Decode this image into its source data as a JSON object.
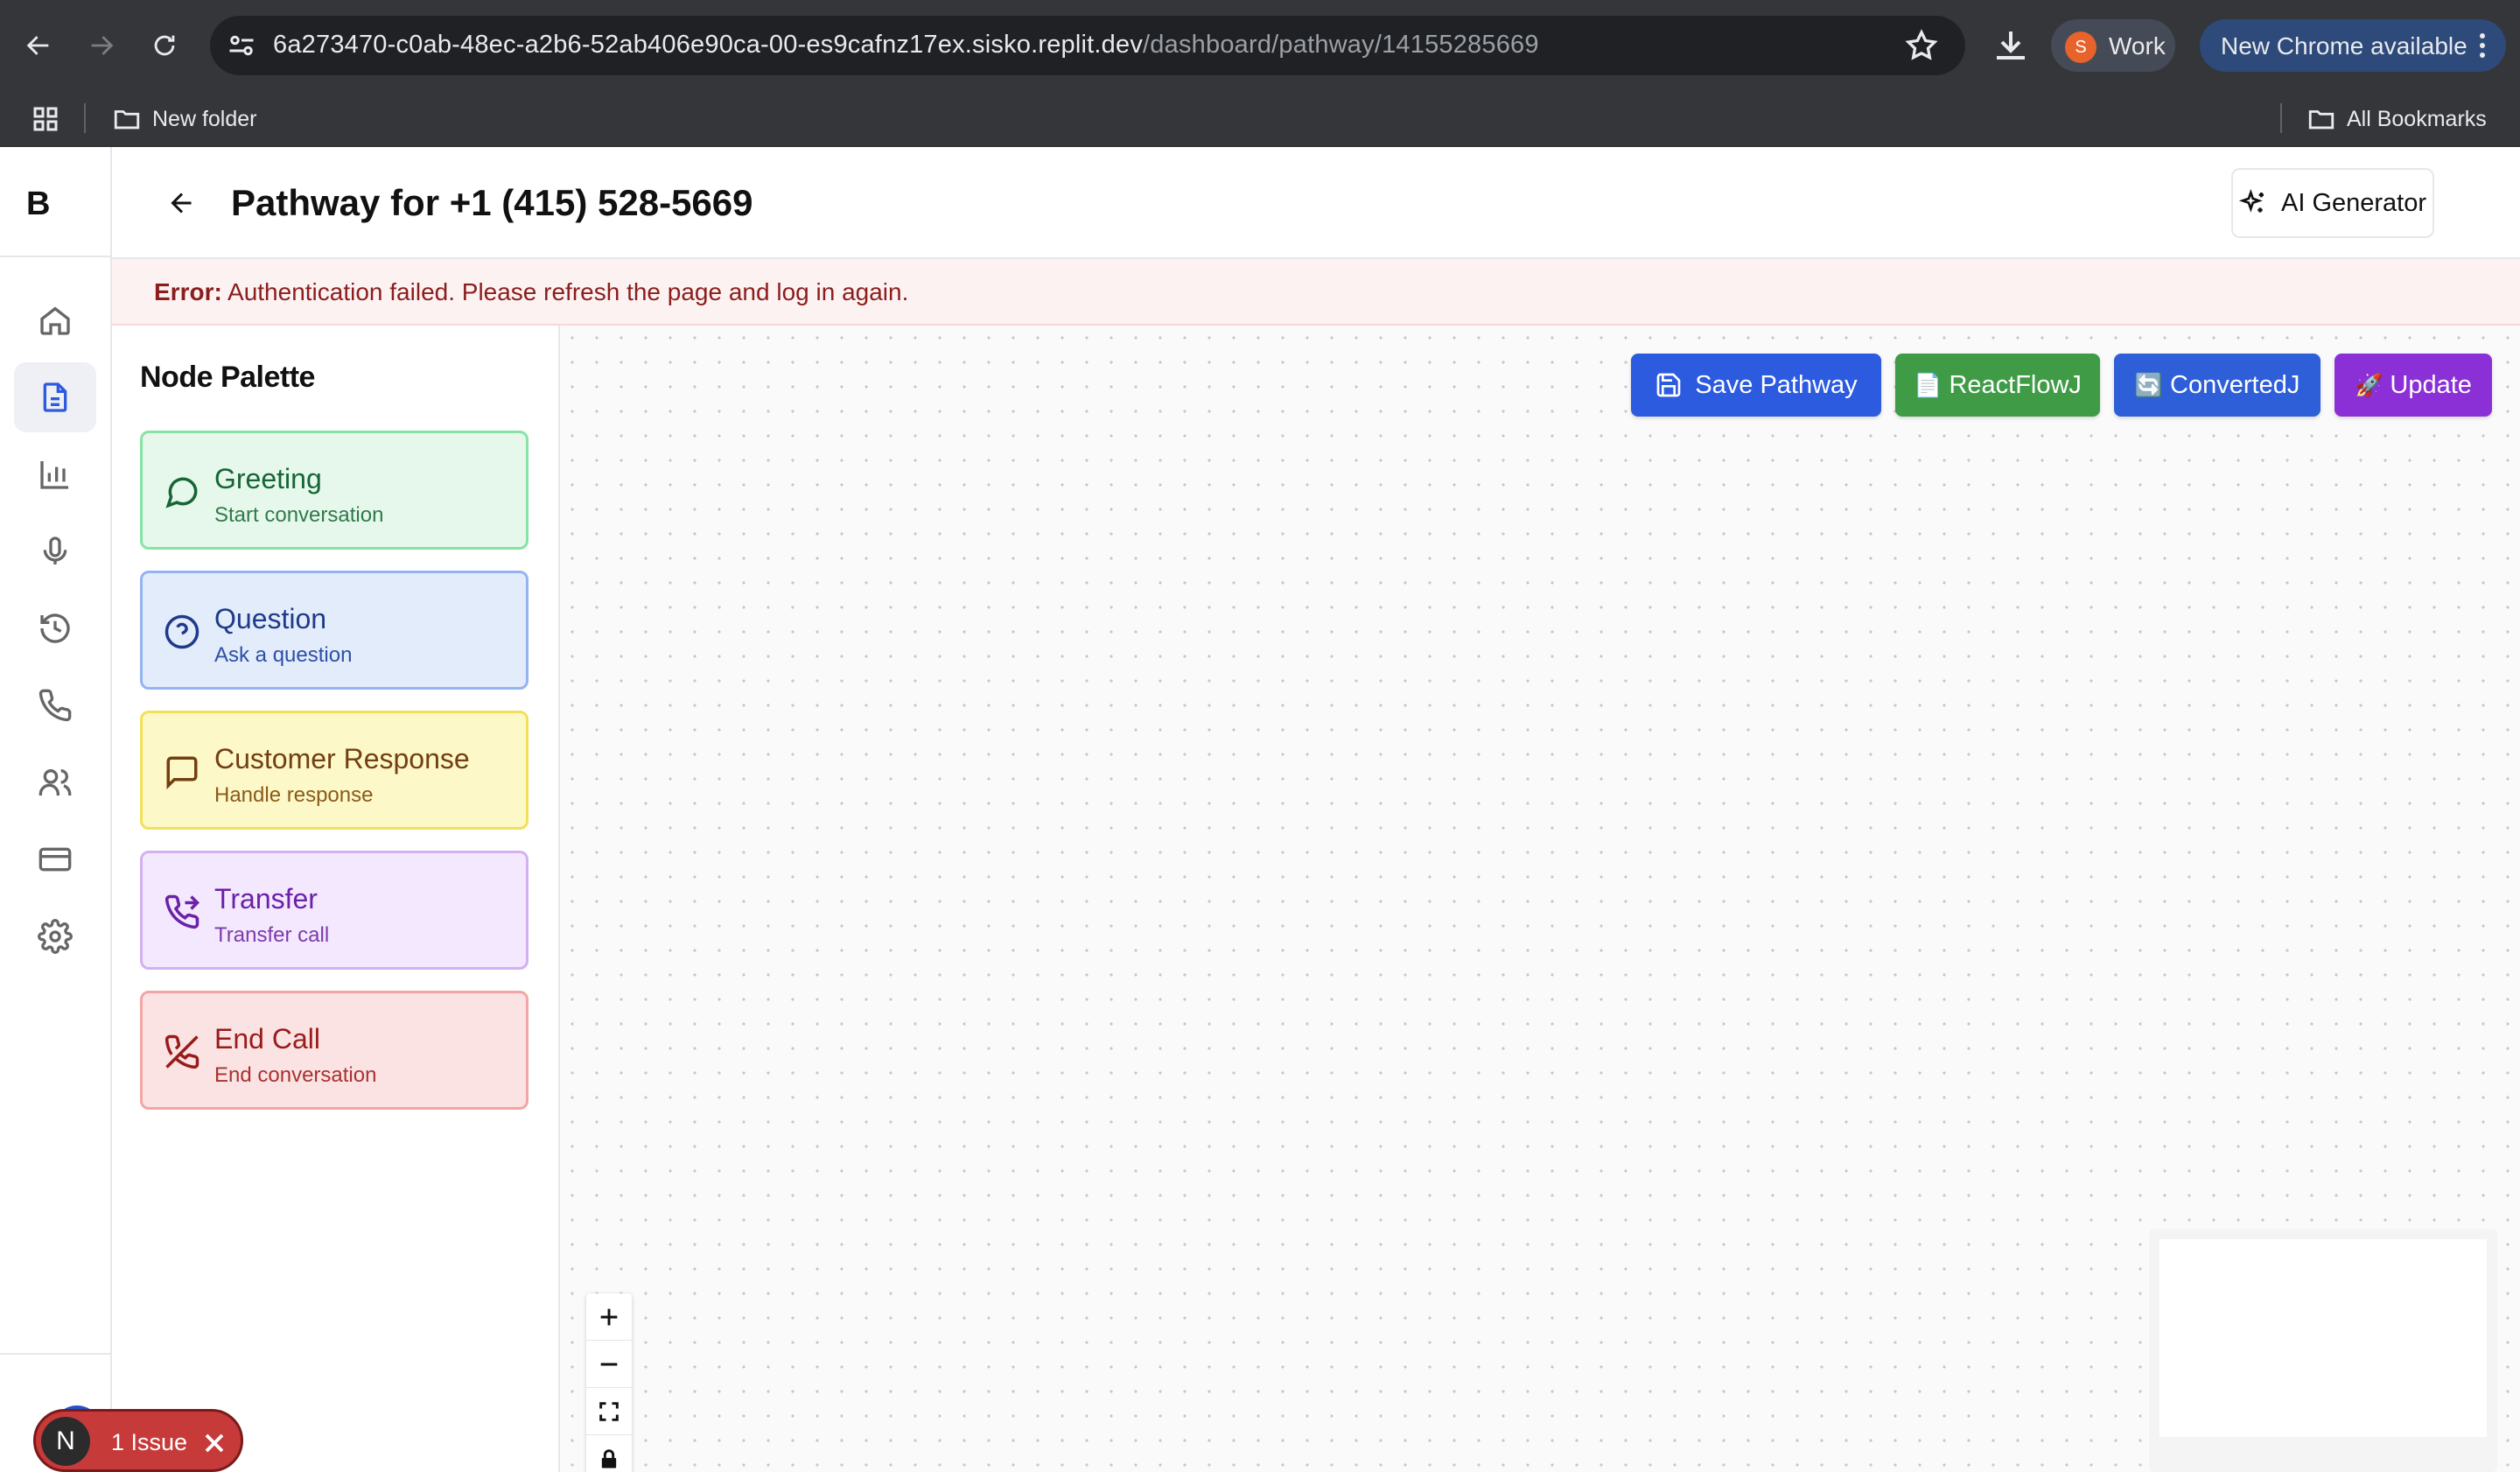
{
  "browser": {
    "url_host": "6a273470-c0ab-48ec-a2b6-52ab406e90ca-00-es9cafnz17ex.sisko.replit.dev",
    "url_path": "/dashboard/pathway/14155285669",
    "profile_initial": "S",
    "profile_label": "Work",
    "update_label": "New Chrome available",
    "bookmarks": {
      "folder": "New folder",
      "all": "All Bookmarks"
    }
  },
  "app": {
    "logo": "B",
    "sidebar": [
      "home-icon",
      "document-icon",
      "bar-chart-icon",
      "microphone-icon",
      "history-icon",
      "phone-icon",
      "users-icon",
      "credit-card-icon",
      "settings-icon"
    ],
    "active_sidebar": "document-icon"
  },
  "header": {
    "title": "Pathway for +1 (415) 528-5669",
    "ai_button": "AI Generator"
  },
  "error": {
    "label": "Error:",
    "message": "Authentication failed. Please refresh the page and log in again."
  },
  "palette": {
    "title": "Node Palette",
    "nodes": [
      {
        "name": "Greeting",
        "desc": "Start conversation",
        "icon": "message-circle-icon",
        "bg": "#e6f8ec",
        "border": "#86e3a5",
        "text": "#166534",
        "sub": "#2f7a48"
      },
      {
        "name": "Question",
        "desc": "Ask a question",
        "icon": "help-circle-icon",
        "bg": "#e3ecfb",
        "border": "#93b4f0",
        "text": "#1e3a8a",
        "sub": "#2d4fa6"
      },
      {
        "name": "Customer Response",
        "desc": "Handle response",
        "icon": "message-square-icon",
        "bg": "#fdf8c8",
        "border": "#f2e05a",
        "text": "#713f12",
        "sub": "#8a5a1a"
      },
      {
        "name": "Transfer",
        "desc": "Transfer call",
        "icon": "phone-forward-icon",
        "bg": "#f3e8fd",
        "border": "#d2b1f3",
        "text": "#6b21a8",
        "sub": "#7c3aad"
      },
      {
        "name": "End Call",
        "desc": "End conversation",
        "icon": "phone-off-icon",
        "bg": "#fbe3e3",
        "border": "#f3a5a5",
        "text": "#991b1b",
        "sub": "#a83232"
      }
    ]
  },
  "toolbar": {
    "save": {
      "label": "Save Pathway",
      "color": "#2c5be0"
    },
    "reactflow": {
      "label": "ReactFlowJ",
      "emoji": "📄",
      "color": "#3f9b46"
    },
    "converted": {
      "label": "ConvertedJ",
      "emoji": "🔄",
      "color": "#2f5fd8"
    },
    "update": {
      "label": "Update",
      "emoji": "🚀",
      "color": "#8b2fd6"
    }
  },
  "issues": {
    "badge_initial": "N",
    "label": "1 Issue"
  }
}
